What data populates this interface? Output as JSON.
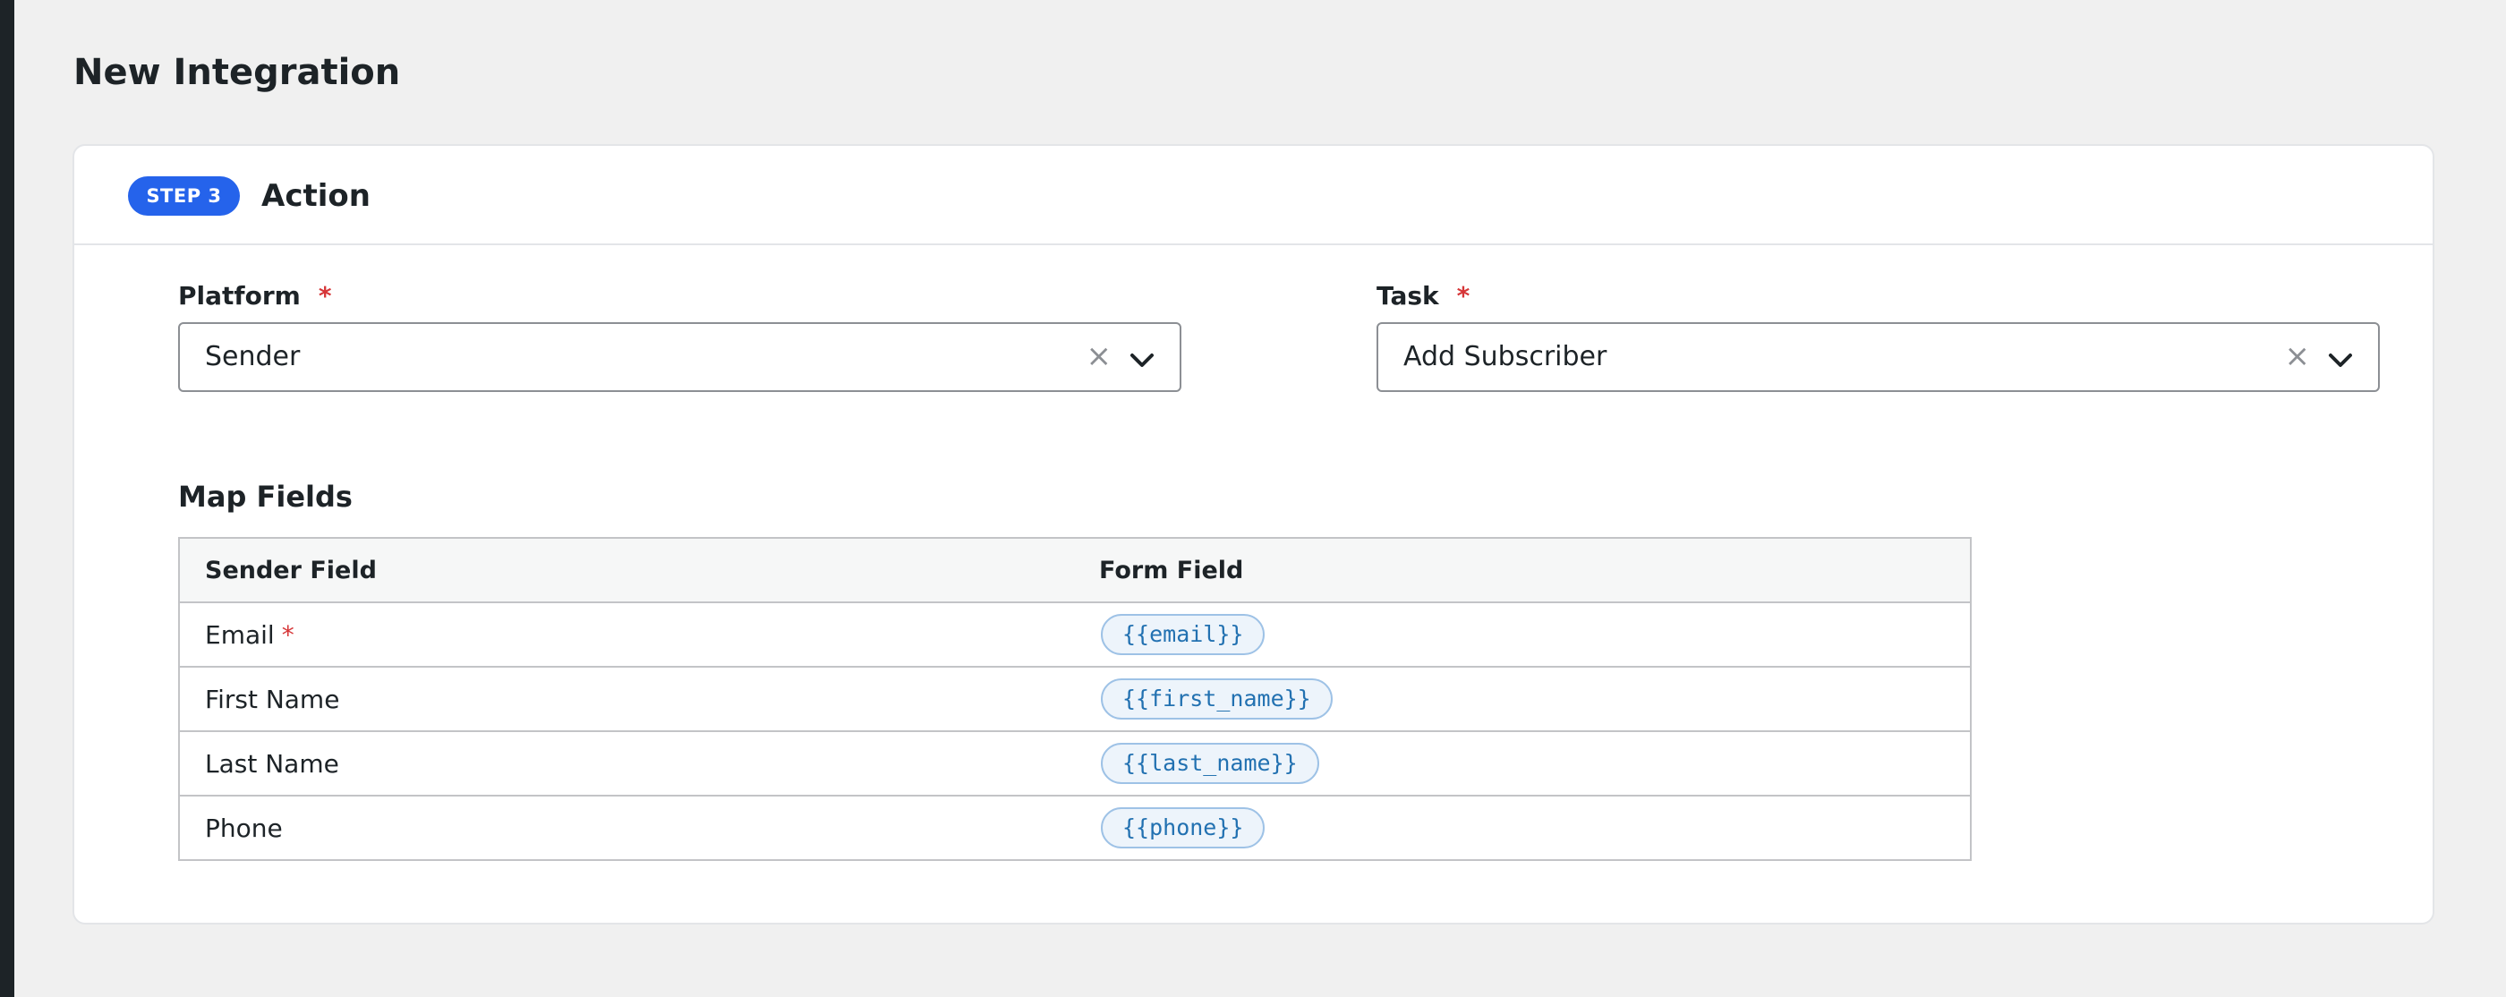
{
  "page": {
    "title": "New Integration"
  },
  "step": {
    "badge": "STEP 3",
    "title": "Action"
  },
  "platform": {
    "label": "Platform",
    "required_mark": "*",
    "value": "Sender",
    "clear_glyph": "×"
  },
  "task": {
    "label": "Task",
    "required_mark": "*",
    "value": "Add Subscriber",
    "clear_glyph": "×"
  },
  "map_fields": {
    "title": "Map Fields",
    "headers": {
      "sender": "Sender Field",
      "form": "Form Field"
    },
    "rows": [
      {
        "sender": "Email",
        "required_mark": "*",
        "form": "{{email}}"
      },
      {
        "sender": "First Name",
        "form": "{{first_name}}"
      },
      {
        "sender": "Last Name",
        "form": "{{last_name}}"
      },
      {
        "sender": "Phone",
        "form": "{{phone}}"
      }
    ]
  },
  "colors": {
    "accent": "#2563eb",
    "required": "#d63638",
    "token_text": "#2271b1",
    "token_bg": "#edf4fb"
  },
  "icons": {
    "dropdown": "chevron-down-icon",
    "clear": "clear-icon"
  }
}
